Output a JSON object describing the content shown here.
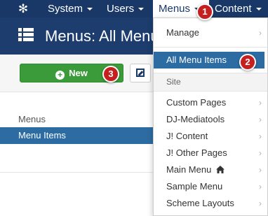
{
  "nav": {
    "brand_icon": "joomla-icon",
    "items": [
      {
        "label": "System"
      },
      {
        "label": "Users"
      },
      {
        "label": "Menus"
      },
      {
        "label": "Content"
      }
    ]
  },
  "header": {
    "title": "Menus: All Menu",
    "icon": "list-icon"
  },
  "toolbar": {
    "new_label": "New",
    "edit_icon": "edit-icon"
  },
  "sidebar": {
    "section_label": "Menus",
    "active_item": "Menu Items"
  },
  "dropdown": {
    "manage": "Manage",
    "all_menu_items": "All Menu Items",
    "site_header": "Site",
    "menus": [
      {
        "label": "Custom Pages"
      },
      {
        "label": "DJ-Mediatools"
      },
      {
        "label": "J! Content"
      },
      {
        "label": "J! Other Pages"
      },
      {
        "label": "Main Menu"
      },
      {
        "label": "Sample Menu"
      },
      {
        "label": "Scheme Layouts"
      }
    ],
    "home_icon": "home-icon"
  },
  "markers": [
    "1",
    "2",
    "3"
  ],
  "colors": {
    "nav_bg": "#1a3867",
    "header_bg": "#1c3d6d",
    "selected": "#2d6ca2",
    "new_button": "#3b9b3b",
    "marker": "#c51f1f"
  }
}
